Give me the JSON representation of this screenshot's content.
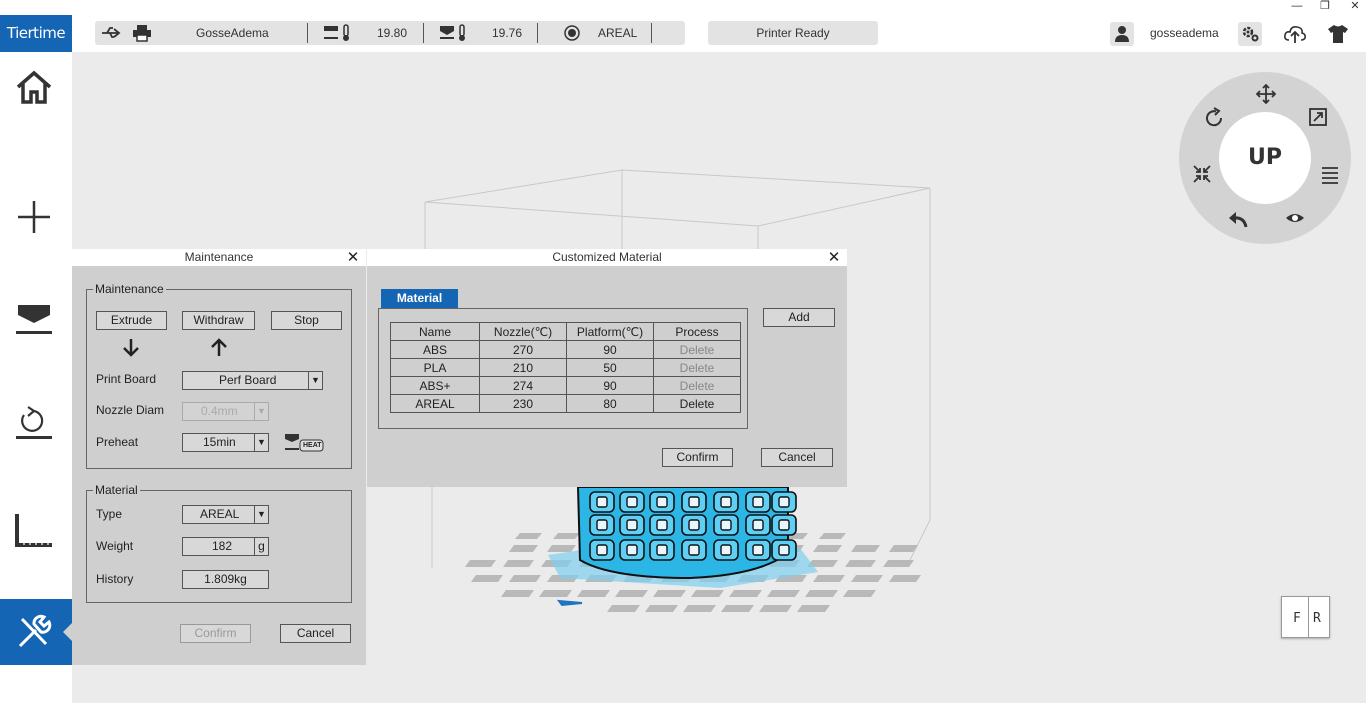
{
  "window": {
    "minimize_glyph": "—",
    "restore_glyph": "❐",
    "close_glyph": "✕"
  },
  "topbar": {
    "brand": "Tiertime",
    "printer_name": "GosseAdema",
    "nozzle_temp": "19.80",
    "platform_temp": "19.76",
    "material": "AREAL",
    "printer_status": "Printer Ready",
    "username": "gosseadema",
    "icons": [
      "usb-icon",
      "printer-icon",
      "nozzle-temp-icon",
      "platform-temp-icon",
      "material-spool-icon",
      "user-icon",
      "settings-icon",
      "cloud-upload-icon",
      "tshirt-icon"
    ]
  },
  "sidebar": {
    "items": [
      {
        "name": "home",
        "icon": "home-icon"
      },
      {
        "name": "add",
        "icon": "plus-icon"
      },
      {
        "name": "print",
        "icon": "print-icon"
      },
      {
        "name": "calibrate",
        "icon": "calibrate-icon"
      },
      {
        "name": "measure",
        "icon": "ruler-icon"
      },
      {
        "name": "maintenance",
        "icon": "tools-icon",
        "active": true
      }
    ],
    "accent": "#1565b5"
  },
  "navwheel": {
    "center_label": "UP",
    "icons": [
      "move-icon",
      "scale-icon",
      "menu-icon",
      "view-icon",
      "undo-icon",
      "shrink-icon",
      "rotate-icon"
    ]
  },
  "viewcube": {
    "front": "F",
    "right": "R"
  },
  "maintenance": {
    "title": "Maintenance",
    "group_maintenance": "Maintenance",
    "extrude": "Extrude",
    "withdraw": "Withdraw",
    "stop": "Stop",
    "print_board_label": "Print Board",
    "print_board_value": "Perf Board",
    "nozzle_diam_label": "Nozzle Diam",
    "nozzle_diam_value": "0.4mm",
    "preheat_label": "Preheat",
    "preheat_value": "15min",
    "heat_badge": "HEAT",
    "group_material": "Material",
    "type_label": "Type",
    "type_value": "AREAL",
    "weight_label": "Weight",
    "weight_value": "182",
    "weight_unit": "g",
    "history_label": "History",
    "history_value": "1.809kg",
    "confirm": "Confirm",
    "cancel": "Cancel"
  },
  "custom_material": {
    "title": "Customized Material",
    "tab": "Material",
    "add": "Add",
    "columns": [
      "Name",
      "Nozzle(℃)",
      "Platform(℃)",
      "Process"
    ],
    "rows": [
      {
        "name": "ABS",
        "nozzle": "270",
        "platform": "90",
        "process": "Delete",
        "enabled": false
      },
      {
        "name": "PLA",
        "nozzle": "210",
        "platform": "50",
        "process": "Delete",
        "enabled": false
      },
      {
        "name": "ABS+",
        "nozzle": "274",
        "platform": "90",
        "process": "Delete",
        "enabled": false
      },
      {
        "name": "AREAL",
        "nozzle": "230",
        "platform": "80",
        "process": "Delete",
        "enabled": true
      }
    ],
    "confirm": "Confirm",
    "cancel": "Cancel"
  },
  "scene": {
    "model_color": "#2bb6e6",
    "platform_highlight": "#7fd0f0"
  }
}
